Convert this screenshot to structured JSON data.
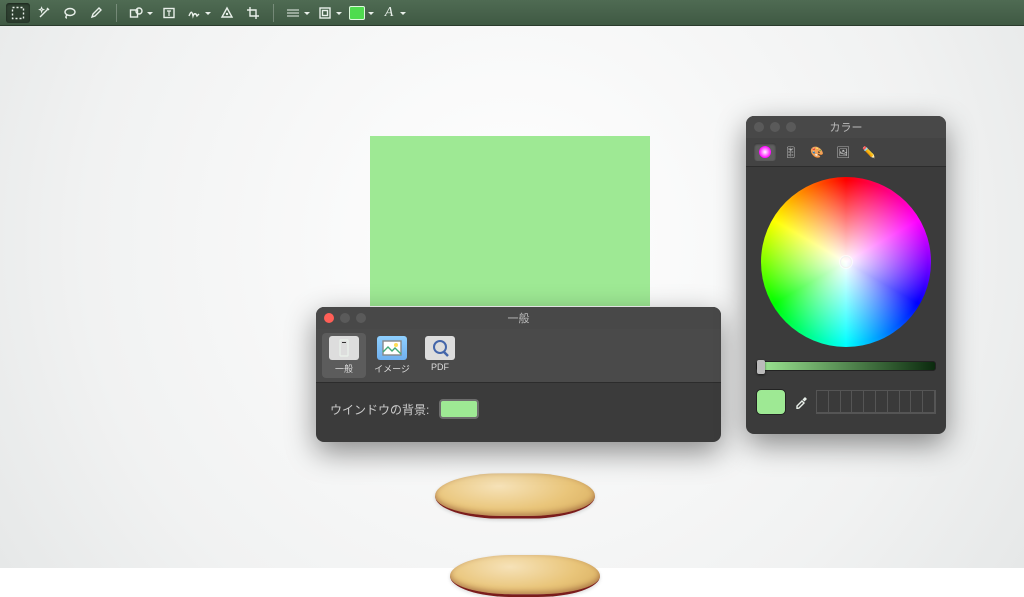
{
  "toolbar": {
    "color_fill": "#4fdc4f"
  },
  "canvas": {
    "green_rect_color": "#9ee994"
  },
  "general_panel": {
    "title": "一般",
    "tabs": {
      "general": "一般",
      "image": "イメージ",
      "pdf": "PDF"
    },
    "window_background_label": "ウインドウの背景:",
    "window_background_color": "#9ee994"
  },
  "colors_panel": {
    "title": "カラー",
    "current_color": "#9ee994"
  }
}
